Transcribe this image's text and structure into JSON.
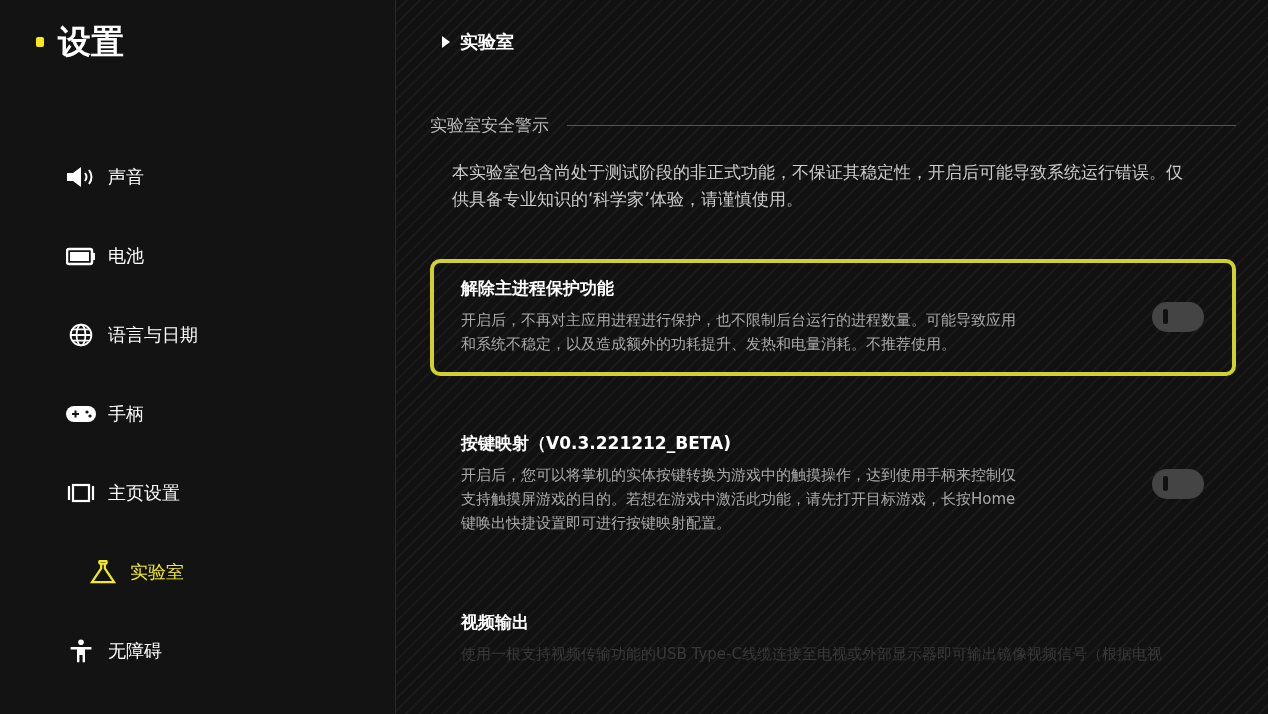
{
  "sidebar": {
    "title": "设置",
    "items": [
      {
        "label": "声音",
        "selected": false
      },
      {
        "label": "电池",
        "selected": false
      },
      {
        "label": "语言与日期",
        "selected": false
      },
      {
        "label": "手柄",
        "selected": false
      },
      {
        "label": "主页设置",
        "selected": false
      },
      {
        "label": "实验室",
        "selected": true
      },
      {
        "label": "无障碍",
        "selected": false
      }
    ]
  },
  "breadcrumb": "实验室",
  "section": {
    "title": "实验室安全警示",
    "text": "本实验室包含尚处于测试阶段的非正式功能，不保证其稳定性，开启后可能导致系统运行错误。仅供具备专业知识的‘科学家’体验，请谨慎使用。"
  },
  "settings": [
    {
      "title": "解除主进程保护功能",
      "description": "开启后，不再对主应用进程进行保护，也不限制后台运行的进程数量。可能导致应用和系统不稳定，以及造成额外的功耗提升、发热和电量消耗。不推荐使用。",
      "selected": true,
      "on": false
    },
    {
      "title": "按键映射（V0.3.221212_BETA)",
      "description": "开启后，您可以将掌机的实体按键转换为游戏中的触摸操作，达到使用手柄来控制仅支持触摸屏游戏的目的。若想在游戏中激活此功能，请先打开目标游戏，长按Home键唤出快捷设置即可进行按键映射配置。",
      "selected": false,
      "on": false
    },
    {
      "title": "视频输出",
      "description": "使用一根支持视频传输功能的USB Type-C线缆连接至电视或外部显示器即可输出镜像视频信号（根据电视",
      "selected": false,
      "faded": true
    }
  ]
}
